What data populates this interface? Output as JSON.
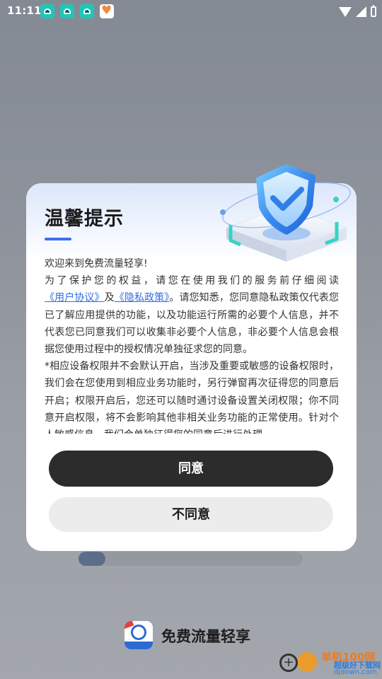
{
  "status_bar": {
    "time": "11:11",
    "notification_icons": [
      "app-notification-icon",
      "app-notification-icon",
      "app-notification-icon",
      "heart-app-icon"
    ],
    "right_icons": [
      "wifi-icon",
      "signal-icon",
      "battery-icon"
    ]
  },
  "dialog": {
    "title": "温馨提示",
    "accent_color": "#3b6ff0",
    "link_color": "#2f6de3",
    "welcome": "欢迎来到免费流量轻享!",
    "para1_prefix": "为了保护您的权益，请您在使用我们的服务前仔细阅读",
    "user_agreement_link": "《用户协议》",
    "and_text": "及",
    "privacy_policy_link": "《隐私政策》",
    "para1_suffix": "。请您知悉，您同意隐私政策仅代表您已了解应用提供的功能，以及功能运行所需的必要个人信息，并不代表您已同意我们可以收集非必要个人信息，非必要个人信息会根据您使用过程中的授权情况单独征求您的同意。",
    "para2": "*相应设备权限并不会默认开启，当涉及重要或敏感的设备权限时，我们会在您使用到相应业务功能时，另行弹窗再次征得您的同意后开启；权限开启后，您还可以随时通讨设备设置关闭权限；你不同意开启权限，将不会影响其他非相关业务功能的正常使用。针对个人敏感信息，我们会单独征得您的同意后进行处理。",
    "agree_button": "同意",
    "disagree_button": "不同意",
    "illustration_icon": "shield-check-icon"
  },
  "background": {
    "progress_fraction": 0.12,
    "app_name": "免费流量轻享",
    "app_icon": "app-logo-icon",
    "watermark_line1": "单机100网",
    "watermark_line2": "超级好下载网",
    "watermark_line3": "djdown.com"
  }
}
